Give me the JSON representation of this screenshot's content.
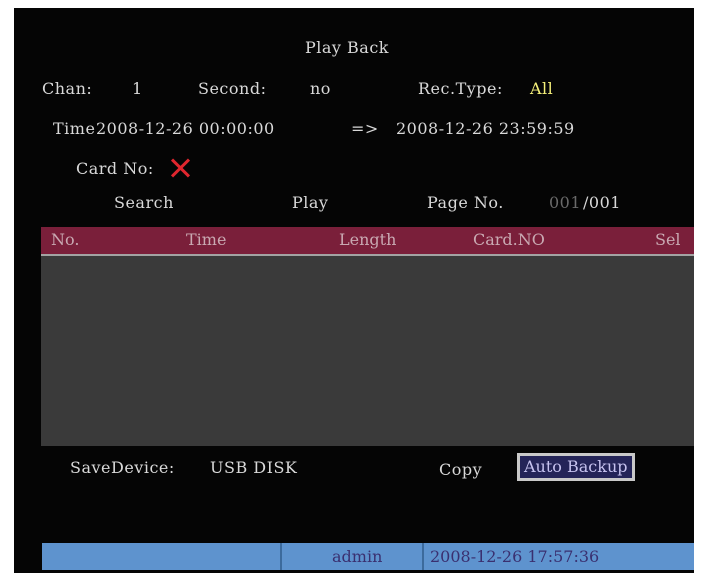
{
  "screen": {
    "title": "Play Back",
    "chan_label": "Chan:",
    "chan_value": "1",
    "second_label": "Second:",
    "second_value": "no",
    "rectype_label": "Rec.Type:",
    "rectype_value": "All",
    "time_label": "Time",
    "time_start": "2008-12-26 00:00:00",
    "time_arrow": "=>",
    "time_end": "2008-12-26 23:59:59",
    "card_label": "Card No:",
    "card_value_icon": "red-x-icon",
    "search_label": "Search",
    "play_label": "Play",
    "page_label": "Page No.",
    "page_current": "001",
    "page_total": "/001",
    "table": {
      "columns": [
        "No.",
        "Time",
        "Length",
        "Card.NO",
        "Sel"
      ],
      "rows": []
    },
    "save_device_label": "SaveDevice:",
    "save_device_value": "USB DISK",
    "copy_label": "Copy",
    "auto_backup_label": "Auto Backup",
    "status": {
      "user": "admin",
      "datetime": "2008-12-26 17:57:36"
    }
  },
  "colors": {
    "background": "#050505",
    "text": "#d9d9d9",
    "highlight_value": "#f5f07a",
    "header_bar": "#7a1f3a",
    "table_body": "#3a3a3a",
    "status_bar": "#5e93ce",
    "card_cross": "#e0262e"
  }
}
